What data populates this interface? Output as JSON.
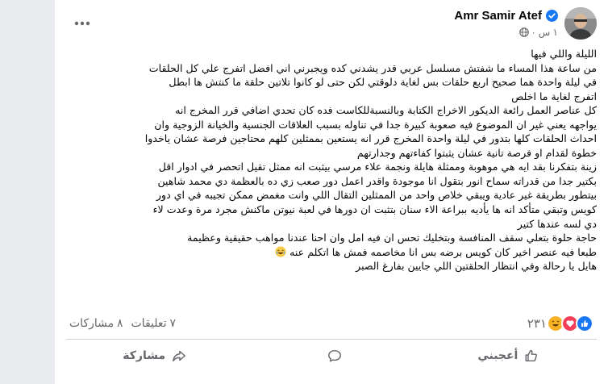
{
  "post": {
    "author": "Amr Samir Atef",
    "time": "١ س",
    "dot": "·",
    "text_lines": [
      "الليلة واللي فيها",
      "من ساعة هذا المساء ما شفتش مسلسل عربي قدر يشدني كده ويجبرني اني افضل اتفرج علي كل الحلقات",
      "في ليلة واحدة هما صحيح اربع حلقات بس لغاية دلوقتي لكن حتى لو كانوا تلاتين حلقة ما كنتش ها ابطل",
      "اتفرج لغاية ما اخلص",
      "كل عناصر العمل رائعة الديكور الاخراج الكتابة وبالنسبةللكاست فده كان تحدي اضافي قرر المخرج انه",
      "يواجهه يعني غير ان الموضوع فيه صعوبة كبيرة جدا في تناوله بسبب العلاقات الجنسية والخيانة الزوجية وان",
      "احداث الحلقات كلها بتدور في ليلة واحدة المخرج قرر انه يستعين بممثلين كلهم محتاجين فرصة عشان ياخدوا",
      "خطوة لقدام او فرصة تانية عشان يثبتوا كفاءتهم وجدارتهم",
      "زينة بتفكرنا بقد ايه هي موهوبة وممثلة هايلة ونجمة علاء مرسي بيثبت انه ممثل تقيل اتحصر في ادوار اقل",
      "بكتير جدا من قدراته سماح انور بتقول انا موجودة واقدر اعمل دور صعب زي ده بالعظمة دي محمد شاهين",
      "بيتطور بطريقة غير عادية ويبقي خلاص واحد من الممثلين التقال اللي وانت مغمض ممكن تجيبه في اي دور",
      "كويس وتبقي متأكد انه ها يأديه ببراعة الاء سنان بتثبت ان دورها في لعبة نيوتن ماكنش مجرد مرة وعدت لاء",
      "دي لسه عندها كتير",
      "حاجة حلوة بتعلي سقف المنافسة وبتخليك تحس ان فيه امل وان احنا عندنا مواهب حقيقية وعظيمة",
      "طبعا فيه عنصر اخير كان كويس برضه بس انا مخاصمه فمش ها اتكلم عنه",
      "هايل يا رحالة وفي انتظار الحلقتين اللي جايين بفارغ الصبر"
    ],
    "emoji": "laughing-emoji"
  },
  "stats": {
    "reaction_count": "٢٣١",
    "comments": "٧ تعليقات",
    "shares": "٨ مشاركات"
  },
  "actions": {
    "like": "أعجبني",
    "comment": "",
    "share": "مشاركة"
  },
  "colors": {
    "like_blue": "#1877f2",
    "love_red": "#f33e58",
    "haha_yellow": "#f7b125",
    "secondary_text": "#65676b"
  }
}
